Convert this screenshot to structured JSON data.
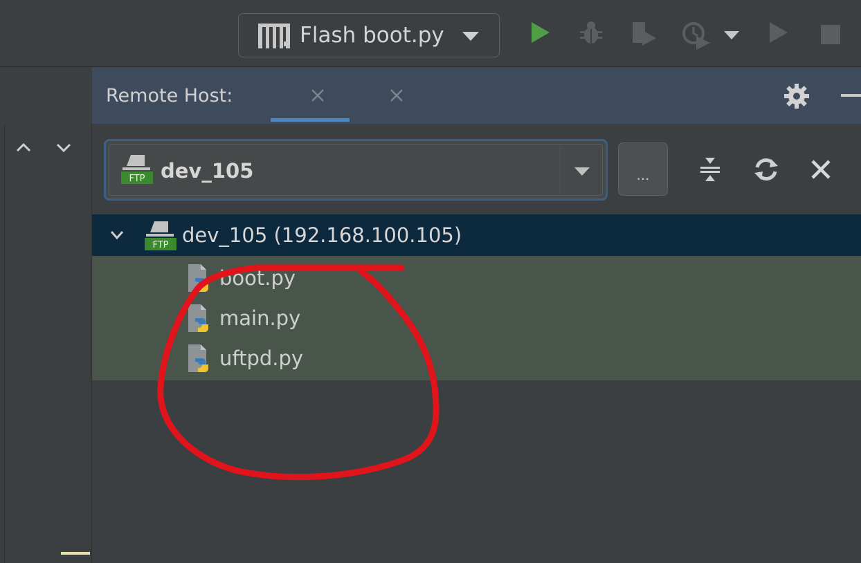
{
  "toolbar": {
    "run_config_label": "Flash boot.py",
    "icons": [
      "micropython-icon",
      "run-icon",
      "debug-icon",
      "coverage-icon",
      "profile-icon",
      "dropdown-icon",
      "resume-icon",
      "stop-icon"
    ],
    "colors": {
      "run": "#4f9e45",
      "inactive": "#5a5e60"
    }
  },
  "panel": {
    "title": "Remote Host:",
    "tabs": [
      {
        "label": "",
        "close_icon": "close-icon",
        "active": true
      },
      {
        "label": "",
        "close_icon": "close-icon",
        "active": false
      }
    ],
    "accent": "#4a88c7"
  },
  "host_selector": {
    "value": "dev_105",
    "icon": "ftp-server-icon",
    "more_label": "..."
  },
  "tree": {
    "root_label": "dev_105 (192.168.100.105)",
    "files": [
      {
        "label": "boot.py"
      },
      {
        "label": "main.py"
      },
      {
        "label": "uftpd.py"
      }
    ],
    "selection_color": "#0d293e",
    "highlight_color": "#49544a"
  },
  "annotation": {
    "color": "#e0141a"
  }
}
